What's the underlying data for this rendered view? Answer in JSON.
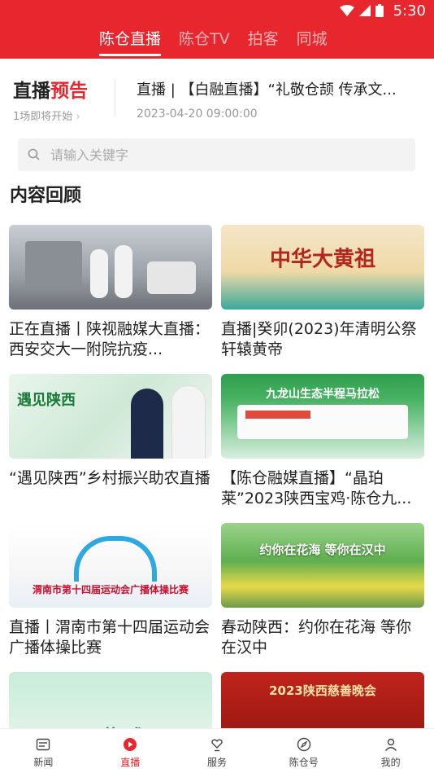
{
  "status_bar": {
    "time": "5:30"
  },
  "top_tabs": [
    {
      "label": "陈仓直播",
      "active": true
    },
    {
      "label": "陈仓TV",
      "active": false
    },
    {
      "label": "拍客",
      "active": false
    },
    {
      "label": "同城",
      "active": false
    }
  ],
  "live_preview": {
    "title_main": "直播",
    "title_accent": "预告",
    "subtitle": "1场即将开始",
    "item_title": "直播 | 【白融直播】“礼敬仓颉 传承文...",
    "item_time": "2023-04-20 09:00:00"
  },
  "search": {
    "placeholder": "请输入关键字"
  },
  "section_title": "内容回顾",
  "cards": [
    {
      "title": "正在直播丨陕视融媒大直播：西安交大一附院抗疫..."
    },
    {
      "title": "直播|癸卯(2023)年清明公祭轩辕黄帝"
    },
    {
      "title": "“遇见陕西”乡村振兴助农直播"
    },
    {
      "title": "【陈仓融媒直播】“晶珀莱”2023陕西宝鸡·陈仓九..."
    },
    {
      "title": "直播丨渭南市第十四届运动会广播体操比赛"
    },
    {
      "title": "春动陕西：约你在花海 等你在汉中"
    },
    {
      "title": ""
    },
    {
      "title": ""
    }
  ],
  "thumb_text": {
    "card2": "中华大黄祖",
    "card3": "遇见陕西",
    "card4": "九龙山生态半程马拉松",
    "card5": "渭南市第十四届运动会广播体操比赛",
    "card6": "约你在花海 等你在汉中",
    "card7": "开 幕 式",
    "card8": "2023陕西慈善晚会"
  },
  "bottom_nav": [
    {
      "label": "新闻",
      "active": false
    },
    {
      "label": "直播",
      "active": true
    },
    {
      "label": "服务",
      "active": false
    },
    {
      "label": "陈仓号",
      "active": false
    },
    {
      "label": "我的",
      "active": false
    }
  ],
  "colors": {
    "brand_red": "#e8262d"
  }
}
